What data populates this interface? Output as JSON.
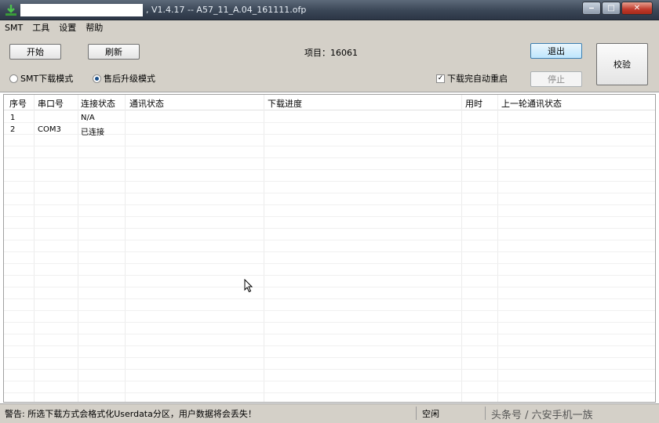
{
  "titlebar": {
    "title": ", V1.4.17 -- A57_11_A.04_161111.ofp",
    "minimize_glyph": "‒",
    "maximize_glyph": "□",
    "close_glyph": "✕"
  },
  "menu": {
    "items": [
      "SMT",
      "工具",
      "设置",
      "帮助"
    ]
  },
  "toolbar": {
    "start_label": "开始",
    "refresh_label": "刷新",
    "project_label": "项目：16061",
    "exit_label": "退出",
    "stop_label": "停止",
    "verify_label": "校验",
    "mode_smt_label": "SMT下载模式",
    "mode_aftersale_label": "售后升级模式",
    "mode_selected": "aftersale",
    "auto_restart_label": "下载完自动重启",
    "auto_restart_checked": true,
    "check_glyph": "✓"
  },
  "table": {
    "columns": [
      "序号",
      "串口号",
      "连接状态",
      "通讯状态",
      "下载进度",
      "用时",
      "上一轮通讯状态"
    ],
    "rows": [
      [
        "1",
        "",
        "N/A",
        "",
        "",
        "",
        ""
      ],
      [
        "2",
        "COM3",
        "已连接",
        "",
        "",
        "",
        ""
      ]
    ]
  },
  "statusbar": {
    "warning": "警告: 所选下载方式会格式化Userdata分区，用户数据将会丢失！",
    "state": "空闲",
    "watermark": "头条号 / 六安手机一族"
  },
  "icons": {
    "app": "download-arrow-icon",
    "cursor": "mouse-pointer-icon"
  },
  "colors": {
    "accent": "#3c7fb1",
    "titlebar": "#3a4656",
    "chrome": "#d4d0c8"
  }
}
